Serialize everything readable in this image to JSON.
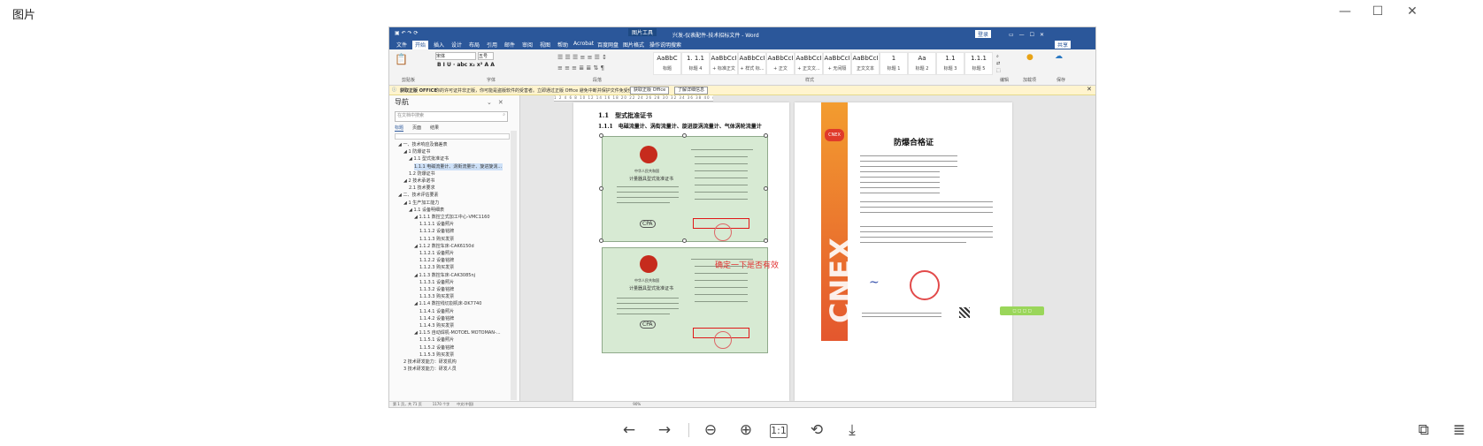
{
  "viewer": {
    "title": "图片",
    "window_buttons": {
      "minimize": "—",
      "maximize": "☐",
      "close": "✕"
    },
    "toolbar": {
      "prev": "←",
      "next": "→",
      "zoom_out": "⊖",
      "zoom_in": "⊕",
      "actual_size": "1:1",
      "rotate": "⟲",
      "download": "⤓",
      "right_left": "⧉",
      "right_right": "≣"
    }
  },
  "word": {
    "title": "兴发-仪表配件-技术招标文件 - Word",
    "picture_tools": "图片工具",
    "login": "登录",
    "ribbon_tabs": [
      "文件",
      "开始",
      "插入",
      "设计",
      "布局",
      "引用",
      "邮件",
      "审阅",
      "视图",
      "帮助",
      "Acrobat",
      "百度网盘",
      "图片格式",
      "操作说明搜索"
    ],
    "share": "共享",
    "font_name": "宋体",
    "font_size": "五号",
    "groups": [
      "剪贴板",
      "字体",
      "段落",
      "样式",
      "编辑",
      "加载项",
      "保存"
    ],
    "styles": [
      {
        "sample": "AaBbC",
        "name": "标题"
      },
      {
        "sample": "1. 1.1",
        "name": "标题 4"
      },
      {
        "sample": "AaBbCcI",
        "name": "+ 标准正文"
      },
      {
        "sample": "AaBbCcI",
        "name": "+ 样式 标..."
      },
      {
        "sample": "AaBbCcI",
        "name": "+ 正文"
      },
      {
        "sample": "AaBbCcI",
        "name": "+ 正文文..."
      },
      {
        "sample": "AaBbCcI",
        "name": "+ 无间隔"
      },
      {
        "sample": "AaBbCcI",
        "name": "正文文本"
      },
      {
        "sample": "1",
        "name": "标题 1"
      },
      {
        "sample": "Aa",
        "name": "标题 2"
      },
      {
        "sample": "1.1",
        "name": "标题 3"
      },
      {
        "sample": "1.1.1",
        "name": "标题 5"
      }
    ],
    "warning": {
      "label": "获取正版 OFFICE",
      "text": "你的许可证并非正版，你可能是盗版软件的受害者。立即通过正版 Office 避免中断并保护文件免受侵害。",
      "btn1": "获取正版 Office",
      "btn2": "了解详细信息"
    },
    "nav": {
      "title": "导航",
      "search_placeholder": "在文档中搜索",
      "tabs": [
        "标题",
        "页面",
        "结果"
      ],
      "items": [
        "一、技术响应及偏差表",
        "1 防爆证书",
        "1.1 型式批准证书",
        "1.1.1 电磁流量计、涡街流量计、旋进旋涡...",
        "1.2 防爆证书",
        "2 技术承诺书",
        "2.1 技术要求",
        "二、技术评估要素",
        "1 生产加工能力",
        "1.1 设备明细表",
        "1.1.1 数控立式加工中心-VMC1160",
        "1.1.1.1 设备照片",
        "1.1.1.2 设备铭牌",
        "1.1.1.3 购买发票",
        "1.1.2 数控车床-CAK6150d",
        "1.1.2.1 设备照片",
        "1.1.2.2 设备铭牌",
        "1.1.2.3 购买发票",
        "1.1.3 数控车床-CAK3085nj",
        "1.1.3.1 设备照片",
        "1.1.3.2 设备铭牌",
        "1.1.3.3 购买发票",
        "1.1.4 数控线切割机床-DK7740",
        "1.1.4.1 设备照片",
        "1.1.4.2 设备铭牌",
        "1.1.4.3 购买发票",
        "1.1.5 自动焊机-MOTOEL MOTOMAN-...",
        "1.1.5.1 设备照片",
        "1.1.5.2 设备铭牌",
        "1.1.5.3 购买发票",
        "2 技术研发能力：研发机构",
        "3 技术研发能力：研发人员"
      ]
    },
    "doc": {
      "h1": "1.1　型式批准证书",
      "h2": "1.1.1　电磁流量计、涡街流量计、旋进旋涡流量计、气体涡轮流量计",
      "cert_title_line1": "中华人民共和国",
      "cert_title_line2": "计量器具型式批准证书",
      "cpa": "CPA",
      "annotation": "确定一下是否有效",
      "right_cert_title": "防爆合格证",
      "right_logo": "CNEX",
      "right_logo_small": "CNEX",
      "wps_bar": "◻ ◻ ◻ ◻"
    },
    "status": "第 1 页，共 71 页　　　1170 个字　　中文(中国)　　　　　　　　　　　　　　　　　　　　　　　　　　　　　　　　　　　　　　　　　　　　　90%"
  }
}
